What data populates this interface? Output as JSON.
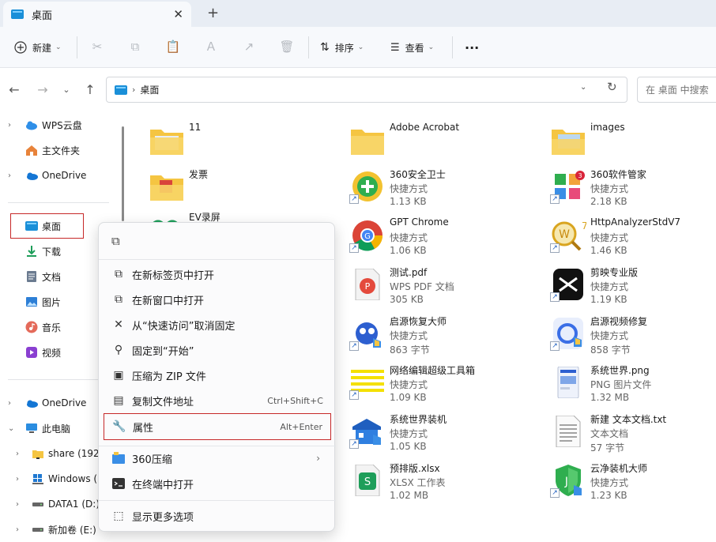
{
  "window": {
    "tab_title": "桌面",
    "tab_close": "✕",
    "new_tab": "+"
  },
  "toolbar": {
    "new_label": "新建",
    "sort_label": "排序",
    "view_label": "查看",
    "more": "···"
  },
  "address": {
    "crumb": "桌面",
    "search_placeholder": "在 桌面 中搜索"
  },
  "sidebar": {
    "items": [
      {
        "label": "WPS云盘"
      },
      {
        "label": "主文件夹"
      },
      {
        "label": "OneDrive"
      },
      {
        "label": "桌面"
      },
      {
        "label": "下载"
      },
      {
        "label": "文档"
      },
      {
        "label": "图片"
      },
      {
        "label": "音乐"
      },
      {
        "label": "视频"
      },
      {
        "label": "OneDrive"
      },
      {
        "label": "此电脑"
      },
      {
        "label": "share (192."
      },
      {
        "label": "Windows ("
      },
      {
        "label": "DATA1 (D:)"
      },
      {
        "label": "新加卷 (E:)"
      }
    ]
  },
  "files": {
    "col1": [
      {
        "name": "11",
        "sub": "",
        "size": ""
      },
      {
        "name": "发票",
        "sub": "",
        "size": ""
      },
      {
        "name": "EV录屏",
        "sub": "",
        "size": ""
      }
    ],
    "col2": [
      {
        "name": "Adobe Acrobat",
        "sub": "",
        "size": ""
      },
      {
        "name": "360安全卫士",
        "sub": "快捷方式",
        "size": "1.13 KB"
      },
      {
        "name": "GPT Chrome",
        "sub": "快捷方式",
        "size": "1.06 KB"
      },
      {
        "name": "测试.pdf",
        "sub": "WPS PDF 文档",
        "size": "305 KB"
      },
      {
        "name": "启源恢复大师",
        "sub": "快捷方式",
        "size": "863 字节"
      },
      {
        "name": "网络编辑超级工具箱",
        "sub": "快捷方式",
        "size": "1.09 KB"
      },
      {
        "name": "系统世界装机",
        "sub": "快捷方式",
        "size": "1.05 KB"
      },
      {
        "name": "预排版.xlsx",
        "sub": "XLSX 工作表",
        "size": "1.02 MB"
      }
    ],
    "col3": [
      {
        "name": "images",
        "sub": "",
        "size": ""
      },
      {
        "name": "360软件管家",
        "sub": "快捷方式",
        "size": "2.18 KB"
      },
      {
        "name": "HttpAnalyzerStdV7",
        "sub": "快捷方式",
        "size": "1.46 KB"
      },
      {
        "name": "剪映专业版",
        "sub": "快捷方式",
        "size": "1.19 KB"
      },
      {
        "name": "启源视频修复",
        "sub": "快捷方式",
        "size": "858 字节"
      },
      {
        "name": "系统世界.png",
        "sub": "PNG 图片文件",
        "size": "1.32 MB"
      },
      {
        "name": "新建 文本文档.txt",
        "sub": "文本文档",
        "size": "57 字节"
      },
      {
        "name": "云净装机大师",
        "sub": "快捷方式",
        "size": "1.23 KB"
      }
    ]
  },
  "context_menu": {
    "items": [
      {
        "label": "在新标签页中打开",
        "key": ""
      },
      {
        "label": "在新窗口中打开",
        "key": ""
      },
      {
        "label": "从“快速访问”取消固定",
        "key": ""
      },
      {
        "label": "固定到“开始”",
        "key": ""
      },
      {
        "label": "压缩为 ZIP 文件",
        "key": ""
      },
      {
        "label": "复制文件地址",
        "key": "Ctrl+Shift+C"
      },
      {
        "label": "属性",
        "key": "Alt+Enter"
      },
      {
        "label": "360压缩",
        "key": ""
      },
      {
        "label": "在终端中打开",
        "key": ""
      },
      {
        "label": "显示更多选项",
        "key": ""
      }
    ]
  },
  "colors": {
    "accent": "#0067c0",
    "highlight_border": "#c62828",
    "folder": "#f5c542"
  }
}
